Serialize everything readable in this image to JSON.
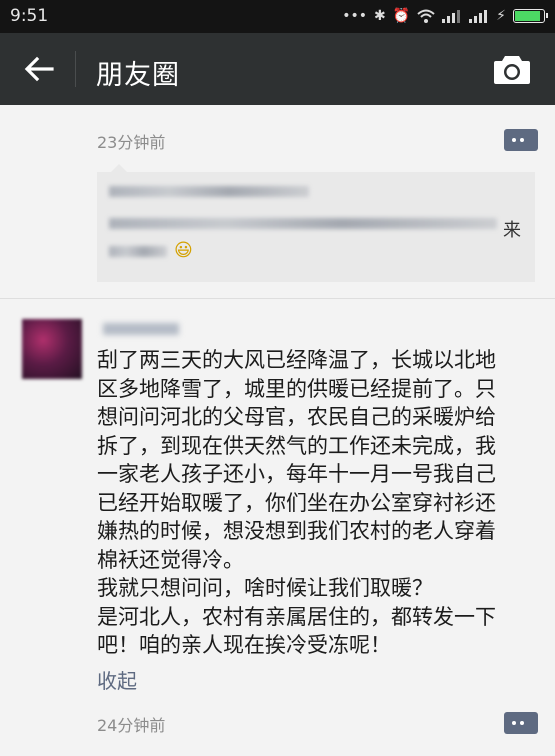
{
  "status_bar": {
    "time": "9:51",
    "icons": [
      "more-dots-icon",
      "bluetooth-icon",
      "alarm-icon",
      "wifi-icon",
      "signal-icon",
      "signal-icon",
      "charging-icon",
      "battery-icon"
    ],
    "battery_level": 0.9,
    "battery_color": "#4cd964"
  },
  "action_bar": {
    "title": "朋友圈",
    "background": "#2e3132"
  },
  "feed": {
    "first_post": {
      "time": "23分钟前",
      "comment_tail": "来",
      "emoji": "😃"
    },
    "second_post": {
      "lines": [
        "刮了两三天的大风已经降温了，长城以北地",
        "区多地降雪了，城里的供暖已经提前了。只",
        "想问问河北的父母官，农民自己的采暖炉给",
        "拆了，到现在供天然气的工作还未完成，我",
        "一家老人孩子还小，每年十一月一号我自己",
        "已经开始取暖了，你们坐在办公室穿衬衫还",
        "嫌热的时候，想没想到我们农村的老人穿着",
        "棉袄还觉得冷。",
        "我就只想问问，啥时候让我们取暖？",
        "是河北人，农村有亲属居住的，都转发一下",
        "吧！咱的亲人现在挨冷受冻呢！"
      ],
      "collapse_label": "收起",
      "time": "24分钟前"
    },
    "link_color": "#5e6a81"
  }
}
